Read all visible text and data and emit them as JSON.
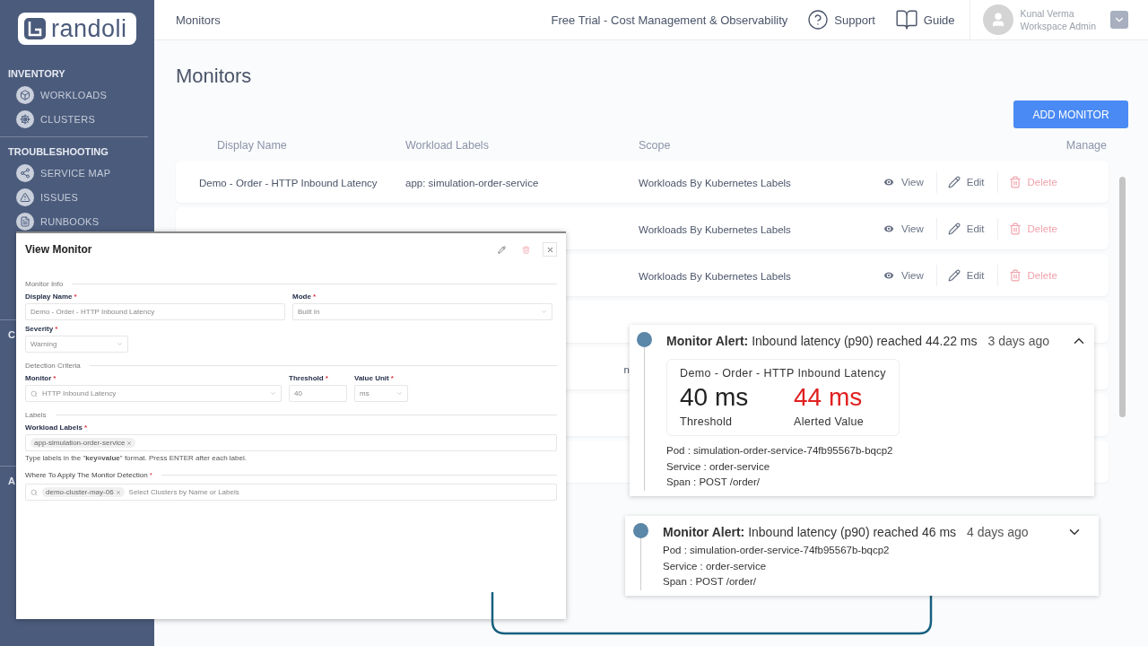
{
  "sidebar": {
    "logo": "randoli",
    "sections": [
      {
        "title": "INVENTORY",
        "items": [
          {
            "label": "WORKLOADS"
          },
          {
            "label": "CLUSTERS"
          }
        ]
      },
      {
        "title": "TROUBLESHOOTING",
        "items": [
          {
            "label": "SERVICE MAP"
          },
          {
            "label": "ISSUES"
          },
          {
            "label": "RUNBOOKS"
          }
        ]
      },
      {
        "title": "C"
      },
      {
        "title": "A"
      }
    ]
  },
  "topbar": {
    "breadcrumb": "Monitors",
    "trial": "Free Trial - Cost Management & Observability",
    "support": "Support",
    "guide": "Guide",
    "user": {
      "name": "Kunal Verma",
      "role": "Workspace Admin"
    }
  },
  "page": {
    "title": "Monitors",
    "add_button": "ADD MONITOR"
  },
  "table": {
    "columns": [
      "Display Name",
      "Workload Labels",
      "Scope",
      "Manage"
    ],
    "rows": [
      {
        "display_name": "Demo - Order - HTTP Inbound Latency",
        "workload_labels": "app: simulation-order-service",
        "scope": "Workloads By Kubernetes Labels",
        "actions": [
          "View",
          "Edit",
          "Delete"
        ]
      },
      {
        "scope": "Workloads By Kubernetes Labels",
        "actions": [
          "View",
          "Edit",
          "Delete"
        ]
      },
      {
        "scope": "Workloads By Kubernetes Labels",
        "actions": [
          "View",
          "Edit",
          "Delete"
        ]
      },
      {
        "kind": "covered"
      },
      {
        "kind": "covered",
        "workload_labels": "n"
      },
      {
        "kind": "covered"
      },
      {
        "kind": "covered"
      }
    ]
  },
  "modal": {
    "title": "View Monitor",
    "sections": [
      {
        "title": "Monitor Info",
        "fields": [
          {
            "label": "Display Name",
            "mark": "*",
            "kind": "text",
            "value": "Demo - Order - HTTP Inbound Latency"
          },
          {
            "label": "Mode",
            "mark": "*",
            "kind": "select",
            "value": "Built In"
          },
          {
            "label": "Severity",
            "mark": "*",
            "kind": "select",
            "value": "Warning"
          }
        ]
      },
      {
        "title": "Detection Criteria",
        "fields": [
          {
            "label": "Monitor",
            "mark": "*",
            "kind": "search_select",
            "value": "HTTP Inbound Latency"
          },
          {
            "label": "Threshold",
            "mark": "*",
            "kind": "text",
            "value": "40"
          },
          {
            "label": "Value Unit",
            "mark": "*",
            "kind": "select",
            "value": "ms"
          }
        ]
      },
      {
        "title": "Labels",
        "fields": [
          {
            "label": "Workload Labels",
            "mark": "*",
            "kind": "chips",
            "chips": [
              "app-simulation-order-service"
            ],
            "hint": "Type labels in the \"**key=value**\" format. Press ENTER after each label."
          }
        ]
      },
      {
        "title": "Where To Apply The Monitor Detection",
        "mark": "*",
        "fields": [
          {
            "kind": "chips_search",
            "chips": [
              "demo-cluster-may-06"
            ],
            "placeholder": "Select Clusters by Name or Labels"
          }
        ]
      }
    ]
  },
  "alerts": [
    {
      "title": "**Monitor Alert:** Inbound latency (p90) reached 44.22 ms",
      "time": "3 days ago",
      "expanded": true,
      "summary": {
        "name": "Demo - Order - HTTP Inbound Latency",
        "threshold": "40 ms",
        "threshold_label": "Threshold",
        "alerted": "44 ms",
        "alerted_label": "Alerted Value"
      },
      "details": [
        "Pod : simulation-order-service-74fb95567b-bqcp2",
        "Service : order-service",
        "Span : POST /order/"
      ]
    },
    {
      "title": "**Monitor Alert:** Inbound latency (p90) reached 46 ms",
      "time": "4 days ago",
      "expanded": false,
      "details": [
        "Pod : simulation-order-service-74fb95567b-bqcp2",
        "Service : order-service",
        "Span : POST /order/"
      ]
    }
  ]
}
